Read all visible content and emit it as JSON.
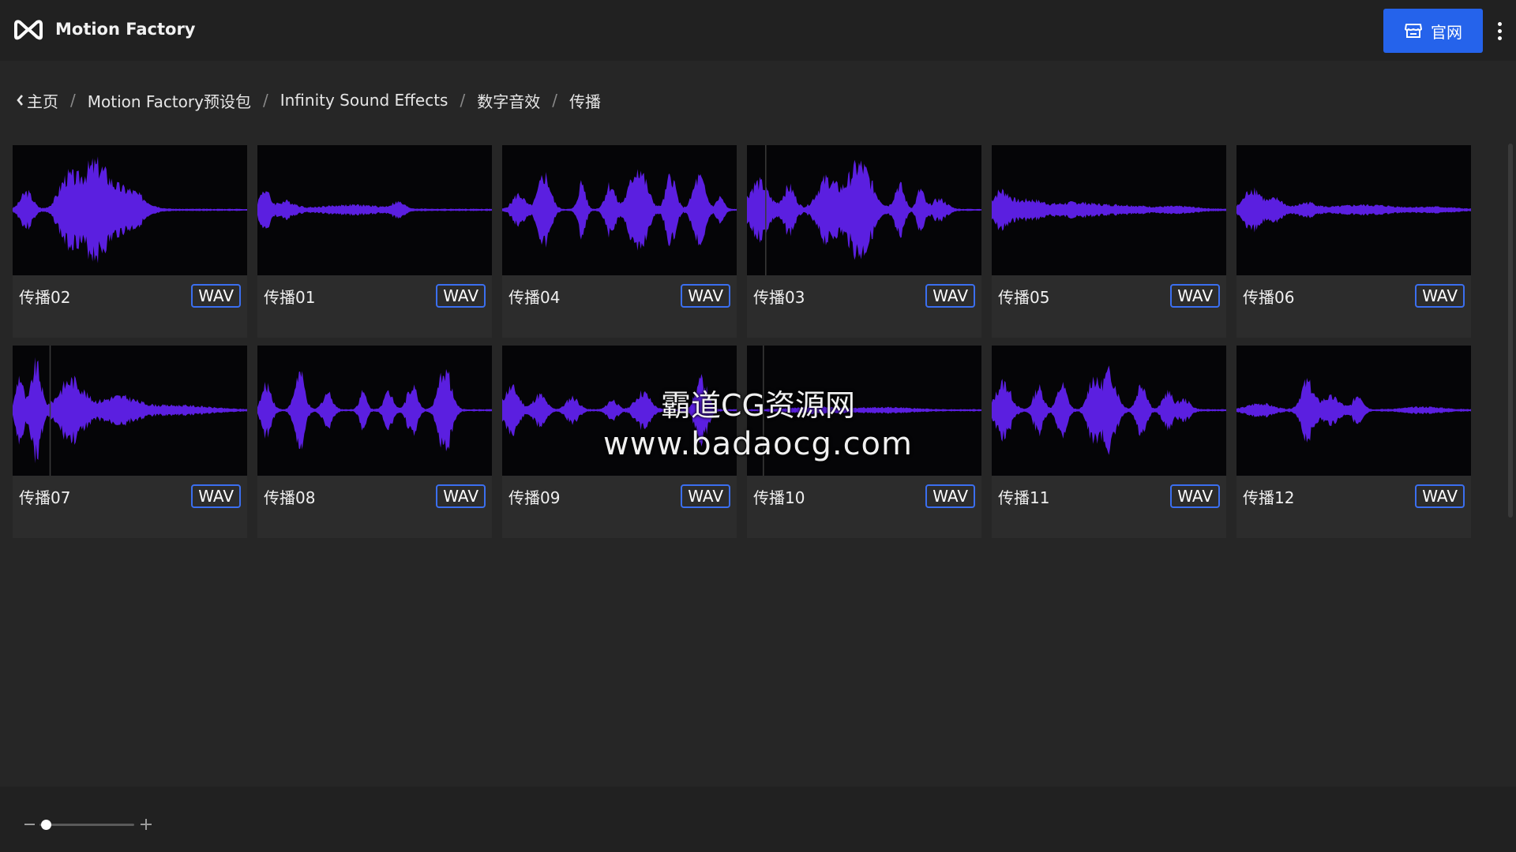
{
  "app": {
    "title": "Motion Factory"
  },
  "header": {
    "site_button_label": "官网"
  },
  "breadcrumb": [
    {
      "label": "主页"
    },
    {
      "label": "Motion Factory预设包"
    },
    {
      "label": "Infinity Sound Effects"
    },
    {
      "label": "数字音效"
    },
    {
      "label": "传播"
    }
  ],
  "items": [
    {
      "name": "传播02",
      "format": "WAV"
    },
    {
      "name": "传播01",
      "format": "WAV"
    },
    {
      "name": "传播04",
      "format": "WAV"
    },
    {
      "name": "传播03",
      "format": "WAV"
    },
    {
      "name": "传播05",
      "format": "WAV"
    },
    {
      "name": "传播06",
      "format": "WAV"
    },
    {
      "name": "传播07",
      "format": "WAV"
    },
    {
      "name": "传播08",
      "format": "WAV"
    },
    {
      "name": "传播09",
      "format": "WAV"
    },
    {
      "name": "传播10",
      "format": "WAV"
    },
    {
      "name": "传播11",
      "format": "WAV"
    },
    {
      "name": "传播12",
      "format": "WAV"
    }
  ],
  "watermark": {
    "line1": "霸道CG资源网",
    "line2": "www.badaocg.com"
  },
  "colors": {
    "accent": "#2563eb",
    "waveform": "#5b1fe0",
    "badge_border": "#3b6ff0"
  },
  "icons": {
    "logo": "motion-factory-logo-icon",
    "site": "storefront-icon",
    "more": "more-vertical-icon",
    "back": "chevron-left-icon"
  }
}
